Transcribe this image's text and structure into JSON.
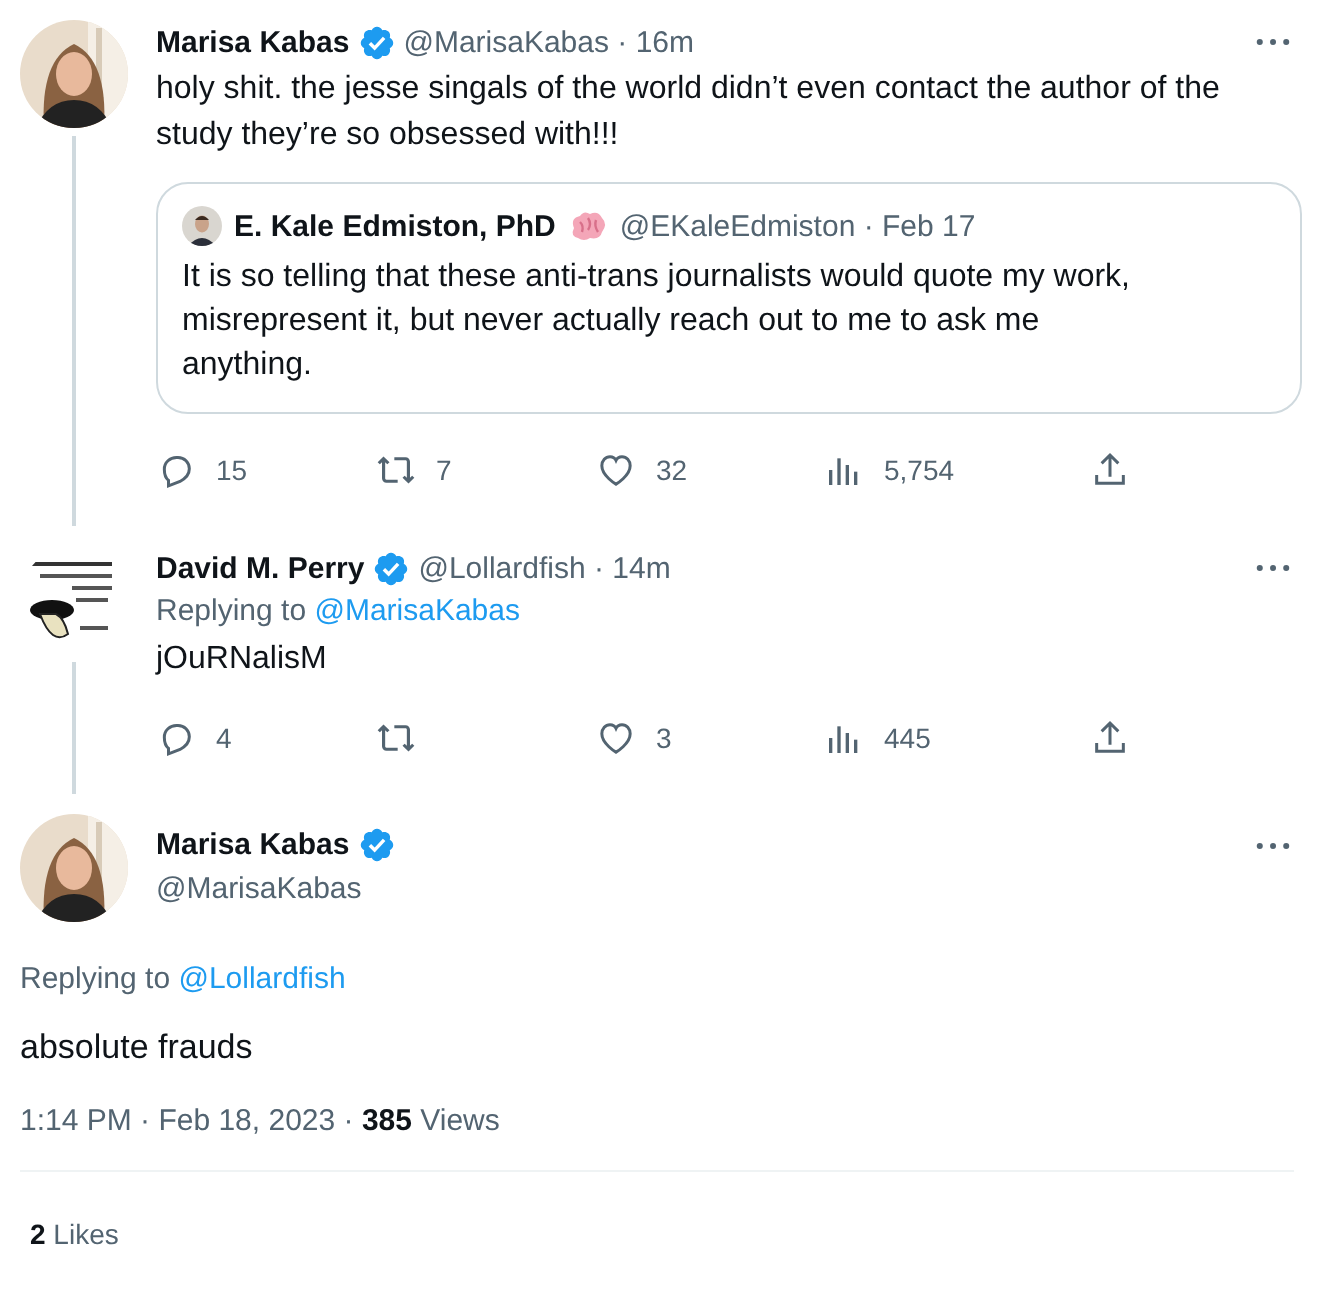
{
  "thread": [
    {
      "name": "Marisa Kabas",
      "verified": true,
      "meta": "@MarisaKabas · 16m",
      "text": "holy shit. the jesse singals of the world didn’t even contact the author of the study they’re so obsessed with!!!",
      "quote": {
        "name": "E. Kale Edmiston, PhD",
        "meta": "@EKaleEdmiston · Feb 17",
        "text": "It is so telling that these anti-trans journalists would quote my work, misrepresent it, but never actually reach out to me to ask me anything."
      },
      "stats": {
        "replies": "15",
        "retweets": "7",
        "likes": "32",
        "views": "5,754"
      }
    },
    {
      "name": "David M. Perry",
      "verified": true,
      "meta": "@Lollardfish · 14m",
      "replying_label": "Replying to",
      "replying_to": "@MarisaKabas",
      "text": "jOuRNalisM",
      "stats": {
        "replies": "4",
        "likes": "3",
        "views": "445"
      }
    }
  ],
  "focused": {
    "name": "Marisa Kabas",
    "verified": true,
    "handle": "@MarisaKabas",
    "replying_label": "Replying to",
    "replying_to": "@Lollardfish",
    "text": "absolute frauds",
    "meta": "1:14 PM · Feb 18, 2023 · **385** Views",
    "likes": "**2** Likes"
  }
}
